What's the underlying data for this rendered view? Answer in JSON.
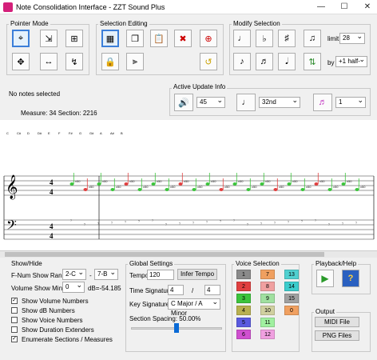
{
  "window": {
    "title": "Note Consolidation Interface - ZZT Sound Plus",
    "minimize": "—",
    "maximize": "☐",
    "close": "✕"
  },
  "pointer_mode": {
    "label": "Pointer Mode"
  },
  "selection_editing": {
    "label": "Selection Editing"
  },
  "modify_selection": {
    "label": "Modify Selection",
    "limit_label": "limit",
    "limit_value": "28",
    "by_label": "by",
    "by_value": "+1 half-"
  },
  "status": {
    "selection": "No notes selected",
    "measure_line": "Measure:  34   Section:  2216"
  },
  "active_update": {
    "label": "Active Update Info",
    "volume": "45",
    "duration": "32nd",
    "voice": "1"
  },
  "score": {
    "letters": [
      "C",
      "C#",
      "D",
      "D#",
      "E",
      "F",
      "F#",
      "G",
      "G#",
      "A",
      "A#",
      "B"
    ],
    "vol_mark": "v50",
    "time_top": "4",
    "time_bottom": "4"
  },
  "show_hide": {
    "label": "Show/Hide",
    "fnum_label": "F-Num Show Range",
    "fnum_from": "2-C",
    "fnum_dash": "-",
    "fnum_to": "7-B",
    "volmin_label": "Volume Show Min",
    "volmin_value": "0",
    "db_text": "dB=-54.185",
    "checks": [
      {
        "label": "Show Volume Numbers",
        "checked": "✓"
      },
      {
        "label": "Show dB Numbers",
        "checked": ""
      },
      {
        "label": "Show Voice Numbers",
        "checked": ""
      },
      {
        "label": "Show Duration Extenders",
        "checked": ""
      },
      {
        "label": "Enumerate Sections / Measures",
        "checked": "✓"
      }
    ]
  },
  "global": {
    "label": "Global Settings",
    "tempo_label": "Tempo",
    "tempo_value": "120",
    "infer_label": "Infer Tempo",
    "ts_label": "Time Signature",
    "ts_top": "4",
    "ts_slash": "/",
    "ts_bottom": "4",
    "key_label": "Key Signature",
    "key_value": "C Major / A Minor",
    "spacing_label": "Section Spacing:  50.00%",
    "spacing_fraction": 0.5
  },
  "voice_selection": {
    "label": "Voice Selection",
    "voices": [
      {
        "n": "1",
        "color": "#8a8a8a"
      },
      {
        "n": "2",
        "color": "#e04040"
      },
      {
        "n": "3",
        "color": "#3cc43c"
      },
      {
        "n": "4",
        "color": "#b8b050"
      },
      {
        "n": "5",
        "color": "#5a5ae0"
      },
      {
        "n": "6",
        "color": "#d050d0"
      },
      {
        "n": "7",
        "color": "#f0a060"
      },
      {
        "n": "8",
        "color": "#f0a0a0"
      },
      {
        "n": "9",
        "color": "#a0e0a0"
      },
      {
        "n": "10",
        "color": "#d0d0a0"
      },
      {
        "n": "11",
        "color": "#a0f0a0"
      },
      {
        "n": "12",
        "color": "#f0a0e0"
      },
      {
        "n": "13",
        "color": "#50d0d0"
      },
      {
        "n": "14",
        "color": "#3ccccc"
      },
      {
        "n": "15",
        "color": "#a0a0a0"
      },
      {
        "n": "0",
        "color": "#f0a060"
      }
    ]
  },
  "playback": {
    "label": "Playback/Help"
  },
  "output": {
    "label": "Output",
    "midi": "MIDI File",
    "png": "PNG Files"
  }
}
